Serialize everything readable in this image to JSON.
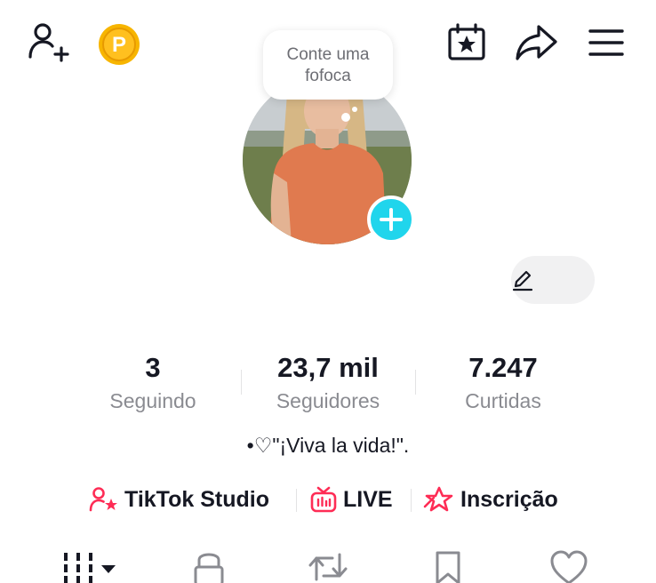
{
  "header": {
    "coin_letter": "P"
  },
  "profile": {
    "note_bubble": "Conte uma fofoca",
    "bio": "•♡\"¡Viva la vida!\"."
  },
  "stats": [
    {
      "value": "3",
      "label": "Seguindo"
    },
    {
      "value": "23,7 mil",
      "label": "Seguidores"
    },
    {
      "value": "7.247",
      "label": "Curtidas"
    }
  ],
  "links": {
    "studio": "TikTok Studio",
    "live": "LIVE",
    "subscription": "Inscrição"
  },
  "colors": {
    "accent_pink": "#fe2c55",
    "plus_badge": "#20d5ec",
    "coin": "#f7b500"
  },
  "icons": {
    "top": [
      "add-friend-icon",
      "coin-icon",
      "calendar-star-icon",
      "share-icon",
      "menu-icon"
    ],
    "tabs": [
      "videos-grid-icon",
      "lock-icon",
      "repost-icon",
      "bookmark-icon",
      "heart-icon"
    ]
  }
}
